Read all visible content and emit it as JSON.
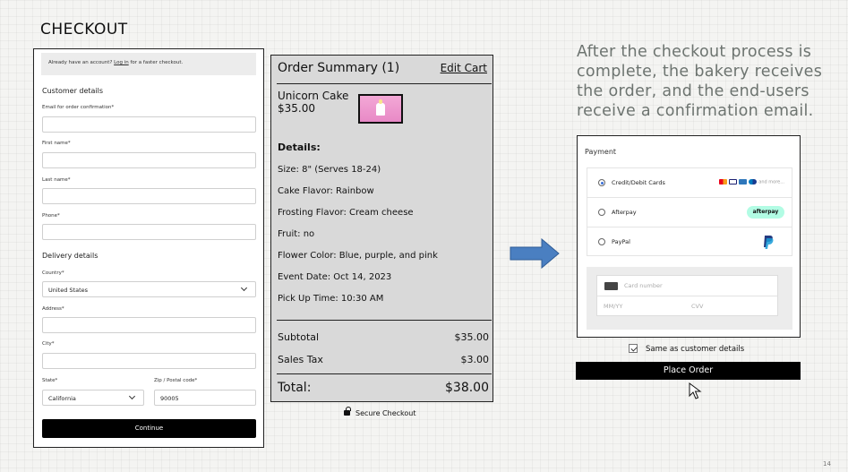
{
  "slide": {
    "title": "CHECKOUT",
    "caption": "After the checkout process is complete, the bakery receives the order, and the end-users receive a confirmation email.",
    "page_number": "14"
  },
  "form": {
    "login_prompt": "Already have an account?",
    "login_link": "Log in",
    "login_suffix": "for a faster checkout.",
    "customer_section": "Customer details",
    "email_label": "Email for order confirmation*",
    "first_name_label": "First name*",
    "last_name_label": "Last name*",
    "phone_label": "Phone*",
    "delivery_section": "Delivery details",
    "country_label": "Country*",
    "country_value": "United States",
    "address_label": "Address*",
    "city_label": "City*",
    "state_label": "State*",
    "state_value": "California",
    "zip_label": "Zip / Postal code*",
    "zip_value": "90005",
    "continue_label": "Continue"
  },
  "summary": {
    "title": "Order Summary (1)",
    "edit_cart": "Edit Cart",
    "item_name": "Unicorn Cake",
    "item_price": "$35.00",
    "details_heading": "Details:",
    "details": [
      "Size: 8\" (Serves 18-24)",
      "Cake Flavor: Rainbow",
      "Frosting Flavor: Cream cheese",
      "Fruit: no",
      "Flower Color: Blue, purple, and pink",
      "Event Date:  Oct 14, 2023",
      "Pick Up Time: 10:30 AM"
    ],
    "subtotal_label": "Subtotal",
    "subtotal_value": "$35.00",
    "tax_label": "Sales Tax",
    "tax_value": "$3.00",
    "total_label": "Total:",
    "total_value": "$38.00",
    "secure_label": "Secure Checkout"
  },
  "payment": {
    "title": "Payment",
    "options": [
      {
        "label": "Credit/Debit Cards",
        "selected": true
      },
      {
        "label": "Afterpay",
        "selected": false
      },
      {
        "label": "PayPal",
        "selected": false
      }
    ],
    "cards_more": "and more...",
    "afterpay_badge": "afterpay",
    "card_number_placeholder": "Card number",
    "expiry_placeholder": "MM/YY",
    "cvv_placeholder": "CVV",
    "same_as_customer": "Same as customer details",
    "place_order": "Place Order"
  },
  "colors": {
    "arrow": "#4a7fc1",
    "summary_bg": "#d9d9d9",
    "caption": "#6d7470",
    "afterpay": "#b2fce4",
    "paypal_dark": "#253b80",
    "paypal_light": "#179bd7"
  }
}
